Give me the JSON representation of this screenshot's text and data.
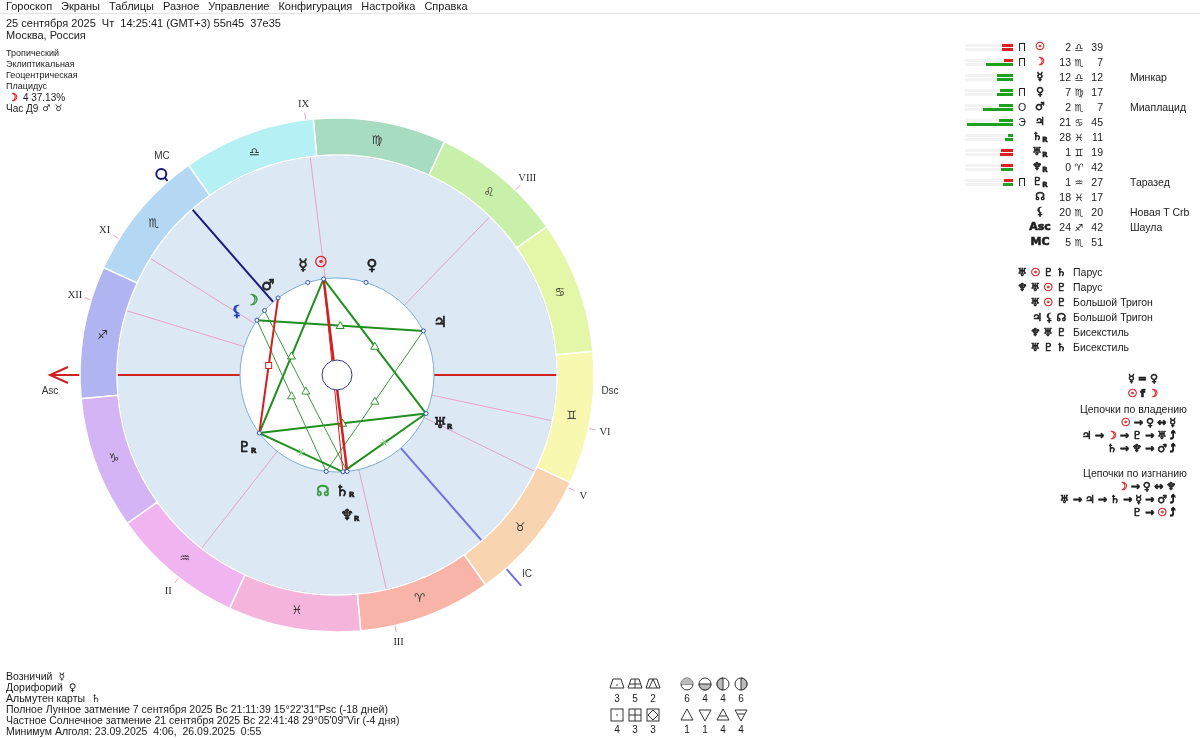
{
  "menu": [
    "Гороскоп",
    "Экраны",
    "Таблицы",
    "Разное",
    "Управление",
    "Конфигурация",
    "Настройка",
    "Справка"
  ],
  "header": {
    "datetime": "25 сентября 2025  Чт  14:25:41 (GMT+3) 55n45  37e35",
    "place": "Москва, Россия",
    "settings": [
      "Тропический",
      "Эклиптикальная",
      "Геоцентрическая",
      "Плацидус"
    ],
    "moon_phase": {
      "glyph": "☽",
      "color": "#e03030",
      "text": "4 37.13%"
    },
    "hour": {
      "text": "Час Д9",
      "glyphs": [
        "♂",
        "♉"
      ]
    }
  },
  "chart": {
    "zodiac": [
      {
        "glyph": "♈",
        "color": "#f8b4a8"
      },
      {
        "glyph": "♉",
        "color": "#f8d4b0"
      },
      {
        "glyph": "♊",
        "color": "#f8f8b0"
      },
      {
        "glyph": "♋",
        "color": "#e4f6a8"
      },
      {
        "glyph": "♌",
        "color": "#c8f0a8"
      },
      {
        "glyph": "♍",
        "color": "#a8dcc0"
      },
      {
        "glyph": "♎",
        "color": "#b4f0f4"
      },
      {
        "glyph": "♏",
        "color": "#b4d8f4"
      },
      {
        "glyph": "♐",
        "color": "#b0b4f0"
      },
      {
        "glyph": "♑",
        "color": "#d4b4f4"
      },
      {
        "glyph": "♒",
        "color": "#f0b4f0"
      },
      {
        "glyph": "♓",
        "color": "#f4b4dc"
      }
    ],
    "houses": [
      {
        "label": "Asc"
      },
      {
        "label": "II"
      },
      {
        "label": "III"
      },
      {
        "label": "IC"
      },
      {
        "label": "V"
      },
      {
        "label": "VI"
      },
      {
        "label": "Dsc"
      },
      {
        "label": "VIII"
      },
      {
        "label": "IX"
      },
      {
        "label": "MC"
      },
      {
        "label": "XI"
      },
      {
        "label": "XII"
      }
    ],
    "planets": [
      {
        "glyph": "☉",
        "color": "#e03030"
      },
      {
        "glyph": "☽",
        "color": "#3a9a3a"
      },
      {
        "glyph": "☿",
        "color": "#202020"
      },
      {
        "glyph": "♀",
        "color": "#202020"
      },
      {
        "glyph": "♂",
        "color": "#202020"
      },
      {
        "glyph": "♃",
        "color": "#202020"
      },
      {
        "glyph": "♄",
        "color": "#202020",
        "suffix": "R"
      },
      {
        "glyph": "♅",
        "color": "#202020",
        "suffix": "R"
      },
      {
        "glyph": "♆",
        "color": "#202020",
        "suffix": "R"
      },
      {
        "glyph": "♇",
        "color": "#202020",
        "suffix": "R"
      },
      {
        "glyph": "☊",
        "color": "#3a9a3a"
      },
      {
        "glyph": "⚸",
        "color": "#2040c0"
      }
    ]
  },
  "positions": [
    {
      "bars": [
        {
          "color": "#e02020",
          "level": 0.22
        },
        {
          "color": "#e02020",
          "level": 0.22
        }
      ],
      "dignity": "П",
      "glyph": "☉",
      "color": "#e03030",
      "degree": "2",
      "sign": "♎",
      "minutes": "39"
    },
    {
      "bars": [
        {
          "color": "#e02020",
          "level": 0.18
        },
        {
          "color": "#20a020",
          "level": 0.56
        }
      ],
      "dignity": "П",
      "glyph": "☽",
      "color": "#e03030",
      "degree": "13",
      "sign": "♏",
      "minutes": "7"
    },
    {
      "bars": [
        {
          "color": "#20a020",
          "level": 0.33
        },
        {
          "color": "#20a020",
          "level": 0.33
        }
      ],
      "glyph": "☿",
      "color": "#202020",
      "degree": "12",
      "sign": "♎",
      "minutes": "12",
      "star": "Минкар"
    },
    {
      "bars": [
        {
          "color": "#20a020",
          "level": 0.27
        },
        {
          "color": "#20a020",
          "level": 0.33
        }
      ],
      "dignity": "П",
      "glyph": "♀",
      "color": "#202020",
      "degree": "7",
      "sign": "♍",
      "minutes": "17"
    },
    {
      "bars": [
        {
          "color": "#20a020",
          "level": 0.3
        },
        {
          "color": "#20a020",
          "level": 0.62
        }
      ],
      "dignity": "О",
      "glyph": "♂",
      "color": "#202020",
      "degree": "2",
      "sign": "♏",
      "minutes": "7",
      "star": "Миаплацид"
    },
    {
      "bars": [
        {
          "color": "#20a020",
          "level": 0.3
        },
        {
          "color": "#20a020",
          "level": 0.95
        }
      ],
      "dignity": "Э",
      "glyph": "♃",
      "color": "#202020",
      "degree": "21",
      "sign": "♋",
      "minutes": "45"
    },
    {
      "bars": [
        {
          "color": "#20a020",
          "level": 0.1
        },
        {
          "color": "#20a020",
          "level": 0.16
        }
      ],
      "glyph": "♄",
      "suffix": "R",
      "color": "#202020",
      "degree": "28",
      "sign": "♓",
      "minutes": "11"
    },
    {
      "bars": [
        {
          "color": "#e02020",
          "level": 0.24
        },
        {
          "color": "#e02020",
          "level": 0.28
        }
      ],
      "glyph": "♅",
      "suffix": "R",
      "color": "#202020",
      "degree": "1",
      "sign": "♊",
      "minutes": "19"
    },
    {
      "bars": [
        {
          "color": "#e02020",
          "level": 0.24
        },
        {
          "color": "#20a020",
          "level": 0.24
        }
      ],
      "glyph": "♆",
      "suffix": "R",
      "color": "#202020",
      "degree": "0",
      "sign": "♈",
      "minutes": "42"
    },
    {
      "bars": [
        {
          "color": "#e02020",
          "level": 0.18
        },
        {
          "color": "#20a020",
          "level": 0.2
        }
      ],
      "dignity": "П",
      "glyph": "♇",
      "suffix": "R",
      "color": "#202020",
      "degree": "1",
      "sign": "♒",
      "minutes": "27",
      "star": "Таразед"
    },
    {
      "glyph": "☊",
      "color": "#202020",
      "degree": "18",
      "sign": "♓",
      "minutes": "17"
    },
    {
      "glyph": "⚸",
      "color": "#202020",
      "degree": "20",
      "sign": "♏",
      "minutes": "20",
      "star": "Новая T Crb"
    },
    {
      "glyph": "Asc",
      "color": "#202020",
      "degree": "24",
      "sign": "♐",
      "minutes": "42",
      "star": "Шаула"
    },
    {
      "glyph": "MC",
      "color": "#202020",
      "degree": "5",
      "sign": "♏",
      "minutes": "51"
    }
  ],
  "figures": [
    {
      "glyphs": [
        {
          "text": "♅",
          "color": "#202020"
        },
        {
          "text": "☉",
          "color": "#e03030"
        },
        {
          "text": "♇",
          "color": "#202020"
        },
        {
          "text": "♄",
          "color": "#202020"
        }
      ],
      "name": "Парус"
    },
    {
      "glyphs": [
        {
          "text": "♆",
          "color": "#202020"
        },
        {
          "text": "♅",
          "color": "#202020"
        },
        {
          "text": "☉",
          "color": "#e03030"
        },
        {
          "text": "♇",
          "color": "#202020"
        }
      ],
      "name": "Парус"
    },
    {
      "glyphs": [
        {
          "text": "♅",
          "color": "#202020"
        },
        {
          "text": "☉",
          "color": "#e03030"
        },
        {
          "text": "♇",
          "color": "#202020"
        }
      ],
      "name": "Большой Тригон"
    },
    {
      "glyphs": [
        {
          "text": "♃",
          "color": "#202020"
        },
        {
          "text": "⚸",
          "color": "#202020"
        },
        {
          "text": "☊",
          "color": "#202020"
        }
      ],
      "name": "Большой Тригон"
    },
    {
      "glyphs": [
        {
          "text": "♆",
          "color": "#202020"
        },
        {
          "text": "♅",
          "color": "#202020"
        },
        {
          "text": "♇",
          "color": "#202020"
        }
      ],
      "name": "Бисекстиль"
    },
    {
      "glyphs": [
        {
          "text": "♅",
          "color": "#202020"
        },
        {
          "text": "♇",
          "color": "#202020"
        },
        {
          "text": "♄",
          "color": "#202020"
        }
      ],
      "name": "Бисекстиль"
    }
  ],
  "rules": [
    [
      {
        "text": "☿",
        "color": "#202020"
      },
      {
        "text": "=",
        "color": "#202020"
      },
      {
        "text": "♀",
        "color": "#202020"
      }
    ],
    [
      {
        "text": "☉",
        "color": "#e03030"
      },
      {
        "text": "f",
        "color": "#202020"
      },
      {
        "text": "☽",
        "color": "#e03030"
      }
    ]
  ],
  "chains": [
    {
      "title": "Цепочки по владению",
      "lines": [
        [
          {
            "text": "☉",
            "color": "#e03030"
          },
          {
            "text": "→",
            "color": "#202020"
          },
          {
            "text": "♀",
            "color": "#202020"
          },
          {
            "text": "↔",
            "color": "#202020"
          },
          {
            "text": "☿",
            "color": "#202020"
          }
        ],
        [
          {
            "text": "♃",
            "color": "#202020"
          },
          {
            "text": "→",
            "color": "#202020"
          },
          {
            "text": "☽",
            "color": "#e03030"
          },
          {
            "text": "→",
            "color": "#202020"
          },
          {
            "text": "♇",
            "color": "#202020"
          },
          {
            "text": "→",
            "color": "#202020"
          },
          {
            "text": "♅",
            "color": "#202020"
          },
          {
            "text": "⤴",
            "color": "#202020"
          }
        ],
        [
          {
            "text": "♄",
            "color": "#202020"
          },
          {
            "text": "→",
            "color": "#202020"
          },
          {
            "text": "♆",
            "color": "#202020"
          },
          {
            "text": "→",
            "color": "#202020"
          },
          {
            "text": "♂",
            "color": "#202020"
          },
          {
            "text": "⤴",
            "color": "#202020"
          }
        ]
      ]
    },
    {
      "title": "Цепочки по изгнанию",
      "lines": [
        [
          {
            "text": "☽",
            "color": "#e03030"
          },
          {
            "text": "→",
            "color": "#202020"
          },
          {
            "text": "♀",
            "color": "#202020"
          },
          {
            "text": "↔",
            "color": "#202020"
          },
          {
            "text": "♆",
            "color": "#202020"
          }
        ],
        [
          {
            "text": "♅",
            "color": "#202020"
          },
          {
            "text": "→",
            "color": "#202020"
          },
          {
            "text": "♃",
            "color": "#202020"
          },
          {
            "text": "→",
            "color": "#202020"
          },
          {
            "text": "♄",
            "color": "#202020"
          },
          {
            "text": "→",
            "color": "#202020"
          },
          {
            "text": "☿",
            "color": "#202020"
          },
          {
            "text": "→",
            "color": "#202020"
          },
          {
            "text": "♂",
            "color": "#202020"
          },
          {
            "text": "⤴",
            "color": "#202020"
          }
        ],
        [
          {
            "text": "♇",
            "color": "#202020"
          },
          {
            "text": "→",
            "color": "#202020"
          },
          {
            "text": "☉",
            "color": "#e03030"
          },
          {
            "text": "⤴",
            "color": "#202020"
          }
        ]
      ]
    }
  ],
  "notes": [
    {
      "label": "Возничий",
      "glyph": "☿"
    },
    {
      "label": "Дорифорий",
      "glyph": "♀"
    },
    {
      "label": "Альмутен карты",
      "glyph": "♄"
    }
  ],
  "events": [
    "Полное Лунное затмение 7 сентября 2025 Вс 21:11:39 15°22'31\"Psc (-18 дней)",
    "Частное Солнечное затмение 21 сентября 2025 Вс 22:41:48 29°05'09\"Vir (-4 дня)",
    "Минимум Алголя: 23.09.2025  4:06,  26.09.2025  0:55"
  ],
  "stats": [
    [
      "3",
      "5",
      "2",
      "6",
      "4",
      "4",
      "6"
    ],
    [
      "4",
      "3",
      "3",
      "1",
      "1",
      "4",
      "4"
    ]
  ]
}
